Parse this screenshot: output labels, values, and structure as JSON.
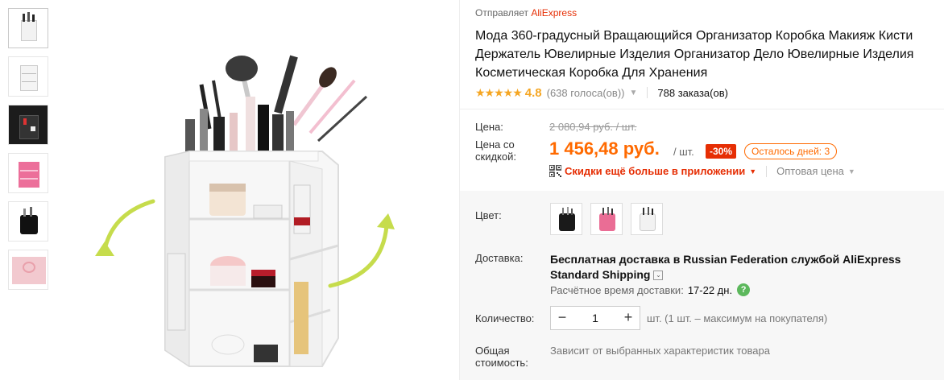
{
  "seller": {
    "prefix": "Отправляет",
    "brand": "AliExpress"
  },
  "title": "Мода 360-градусный Вращающийся Организатор Коробка Макияж Кисти Держатель Ювелирные Изделия Организатор Дело Ювелирные Изделия Косметическая Коробка Для Хранения",
  "rating": {
    "stars": "★★★★★",
    "score": "4.8",
    "votes": "(638 голоса(ов))",
    "orders": "788 заказа(ов)"
  },
  "price": {
    "label": "Цена:",
    "old": "2 080,94 руб. / шт.",
    "discount_label": "Цена со скидкой:",
    "new": "1 456,48 руб.",
    "per_unit": "/ шт.",
    "discount_badge": "-30%",
    "days_left": "Осталось дней: 3"
  },
  "app_deal": {
    "text": "Скидки ещё больше в приложении",
    "wholesale": "Оптовая цена"
  },
  "color": {
    "label": "Цвет:",
    "options": [
      "black",
      "pink",
      "white"
    ]
  },
  "shipping": {
    "label": "Доставка:",
    "line": "Бесплатная доставка в Russian Federation службой AliExpress Standard Shipping",
    "est_label": "Расчётное время доставки:",
    "est_days": "17-22 дн.",
    "help": "?"
  },
  "quantity": {
    "label": "Количество:",
    "minus": "−",
    "value": "1",
    "plus": "+",
    "note": "шт. (1 шт. – максимум на покупателя)"
  },
  "total": {
    "label": "Общая стоимость:",
    "note": "Зависит от выбранных характеристик товара"
  },
  "colors": {
    "accent": "#ff6a00",
    "red": "#e62e04",
    "star": "#f5a623",
    "green": "#5cb85c"
  },
  "thumbnails": [
    "white-organizer",
    "white-organizer-side",
    "black-organizer",
    "pink-organizer",
    "black-organizer-small",
    "pink-gift-box"
  ]
}
